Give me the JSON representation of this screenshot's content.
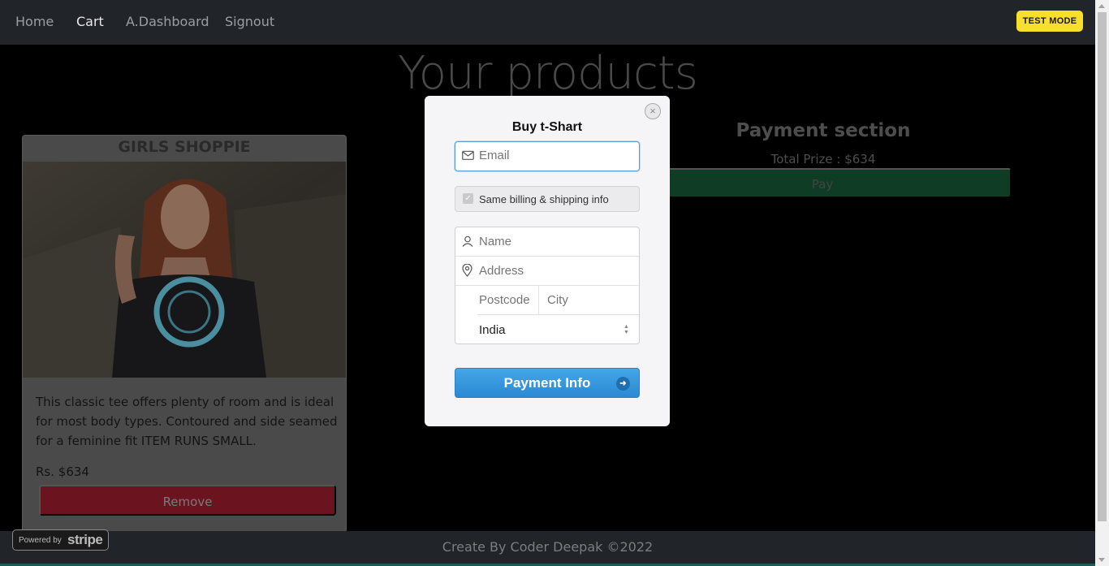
{
  "nav": {
    "items": [
      {
        "label": "Home"
      },
      {
        "label": "Cart"
      },
      {
        "label": "A.Dashboard"
      },
      {
        "label": "Signout"
      }
    ]
  },
  "test_mode": "TEST MODE",
  "page": {
    "title": "Your products"
  },
  "product": {
    "shop": "GIRLS SHOPPIE",
    "description": "This classic tee offers plenty of room and is ideal for most body types. Contoured and side seamed for a feminine fit ITEM RUNS SMALL.",
    "price": "Rs. $634",
    "remove_label": "Remove"
  },
  "payment": {
    "title": "Payment section",
    "total": "Total Prize : $634",
    "pay_label": "Pay"
  },
  "footer": {
    "text": "Create By Coder Deepak ©2022"
  },
  "stripe_badge": {
    "powered": "Powered by",
    "brand": "stripe"
  },
  "modal": {
    "title": "Buy t-Shart",
    "close": "×",
    "email_placeholder": "Email",
    "same_billing": "Same billing & shipping info",
    "name_placeholder": "Name",
    "address_placeholder": "Address",
    "postcode_placeholder": "Postcode",
    "city_placeholder": "City",
    "country": "India",
    "submit_label": "Payment Info",
    "accent": "#2f8fd8"
  }
}
